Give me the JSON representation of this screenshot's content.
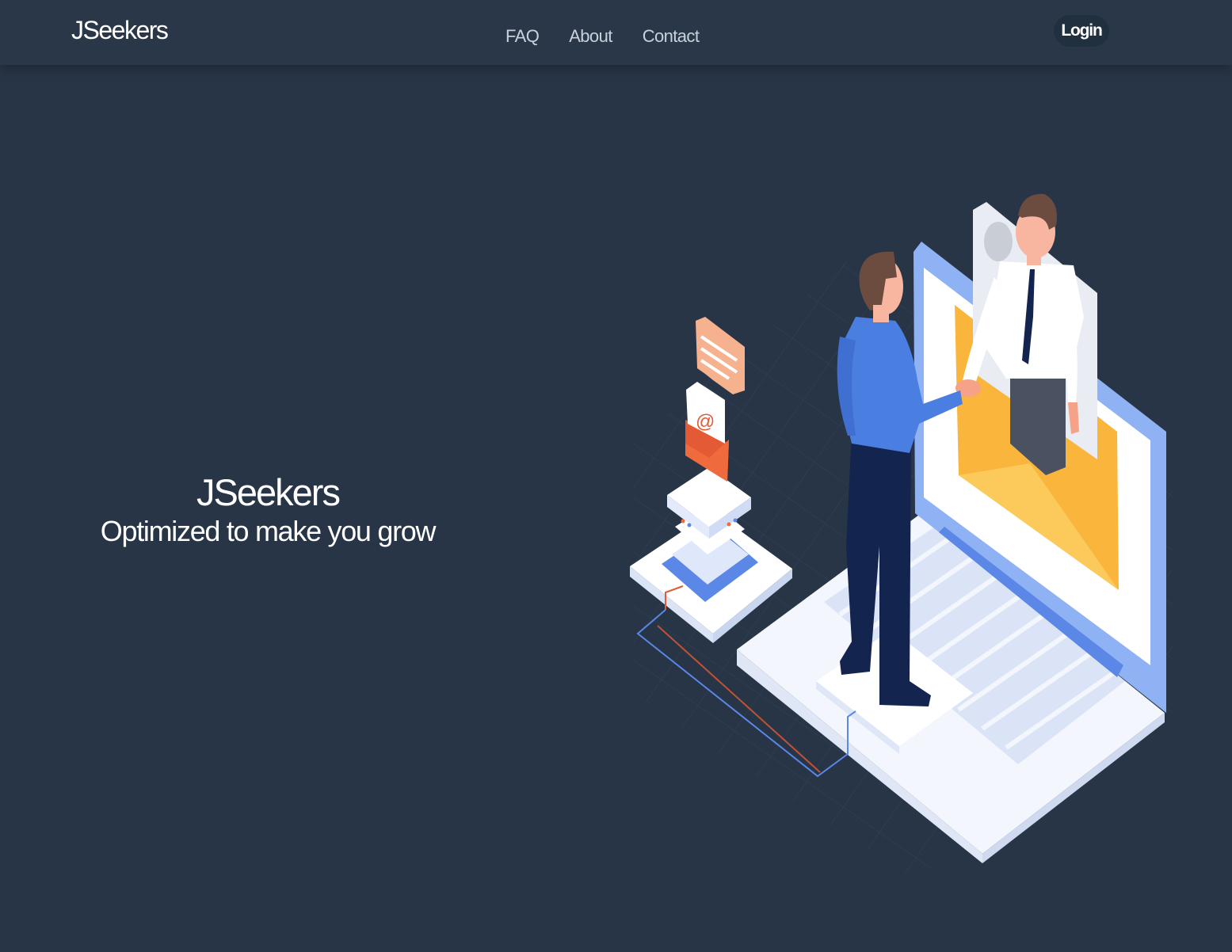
{
  "navbar": {
    "brand": "JSeekers",
    "links": [
      {
        "label": "FAQ"
      },
      {
        "label": "About"
      },
      {
        "label": "Contact"
      }
    ],
    "login_label": "Login"
  },
  "hero": {
    "title": "JSeekers",
    "subtitle": "Optimized to make you grow"
  },
  "colors": {
    "background": "#283547",
    "navbar": "#2a3749",
    "accent_blue": "#4a7ee0",
    "envelope_yellow": "#f9b53c",
    "dark_navy": "#13254f"
  },
  "illustration": {
    "icon": "handshake-laptop-illustration-icon"
  }
}
